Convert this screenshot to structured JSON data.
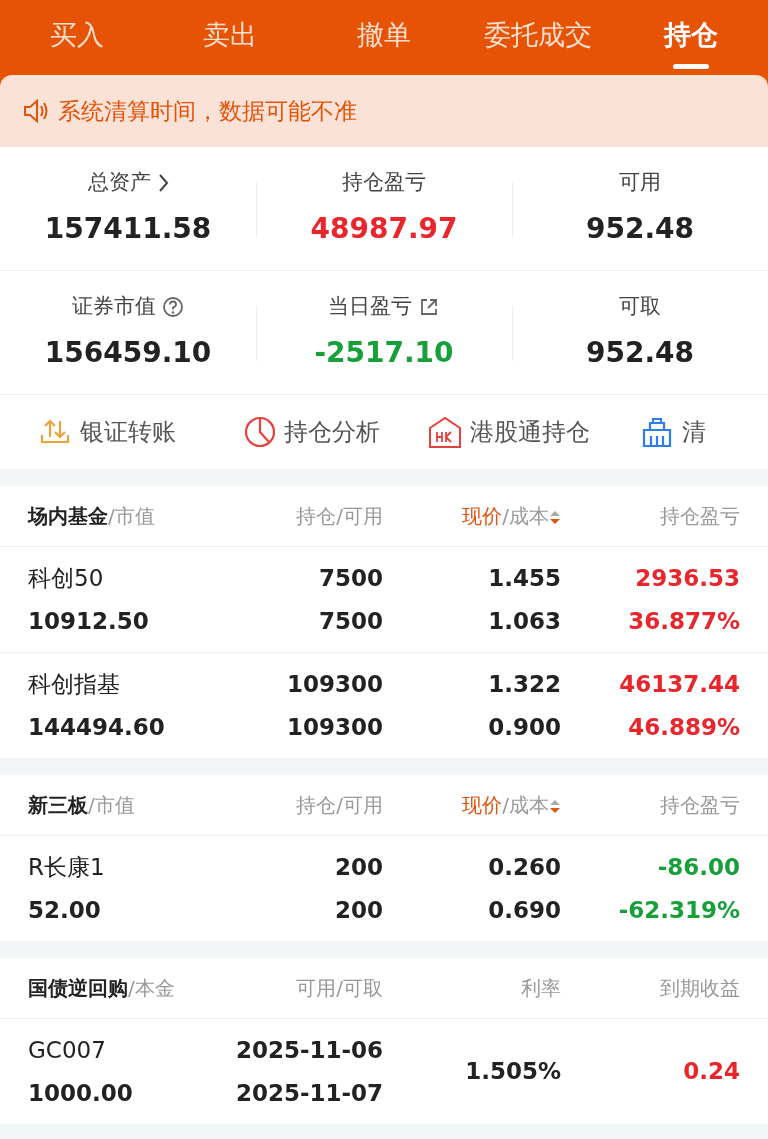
{
  "tabs": [
    {
      "label": "买入",
      "selected": false
    },
    {
      "label": "卖出",
      "selected": false
    },
    {
      "label": "撤单",
      "selected": false
    },
    {
      "label": "委托成交",
      "selected": false
    },
    {
      "label": "持仓",
      "selected": true
    }
  ],
  "notice": "系统清算时间，数据可能不准",
  "summary": [
    {
      "label": "总资产",
      "value": "157411.58",
      "color": "#222222"
    },
    {
      "label": "持仓盈亏",
      "value": "48987.97",
      "color": "#e8262b"
    },
    {
      "label": "可用",
      "value": "952.48",
      "color": "#222222"
    },
    {
      "label": "证券市值",
      "value": "156459.10",
      "color": "#222222"
    },
    {
      "label": "当日盈亏",
      "value": "-2517.10",
      "color": "#17a03a"
    },
    {
      "label": "可取",
      "value": "952.48",
      "color": "#222222"
    }
  ],
  "tools": [
    {
      "label": "银证转账"
    },
    {
      "label": "持仓分析"
    },
    {
      "label": "港股通持仓"
    },
    {
      "label": "清"
    }
  ],
  "sections": [
    {
      "kind": "holding",
      "title": "场内基金",
      "subtitle": "/市值",
      "col2": "持仓/可用",
      "col3": [
        "现价",
        "/成本"
      ],
      "col4": "持仓盈亏",
      "rows": [
        {
          "name": "科创50",
          "value": "10912.50",
          "col2": [
            "7500",
            "7500"
          ],
          "col3": [
            "1.455",
            "1.063"
          ],
          "col4": [
            "2936.53",
            "36.877%"
          ],
          "color": "#e8262b"
        },
        {
          "name": "科创指基",
          "value": "144494.60",
          "col2": [
            "109300",
            "109300"
          ],
          "col3": [
            "1.322",
            "0.900"
          ],
          "col4": [
            "46137.44",
            "46.889%"
          ],
          "color": "#e8262b"
        }
      ]
    },
    {
      "kind": "holding",
      "title": "新三板",
      "subtitle": "/市值",
      "col2": "持仓/可用",
      "col3": [
        "现价",
        "/成本"
      ],
      "col4": "持仓盈亏",
      "rows": [
        {
          "name": "R长康1",
          "value": "52.00",
          "col2": [
            "200",
            "200"
          ],
          "col3": [
            "0.260",
            "0.690"
          ],
          "col4": [
            "-86.00",
            "-62.319%"
          ],
          "color": "#17a03a"
        }
      ]
    },
    {
      "kind": "repo",
      "title": "国债逆回购",
      "subtitle": "/本金",
      "col2": "可用/可取",
      "col3": [
        "利率"
      ],
      "col4": "到期收益",
      "rows": [
        {
          "name": "GC007",
          "value": "1000.00",
          "col2": [
            "2025-11-06",
            "2025-11-07"
          ],
          "col3": [
            "1.505%"
          ],
          "col4": [
            "0.24"
          ],
          "color": "#e8262b"
        }
      ]
    }
  ]
}
